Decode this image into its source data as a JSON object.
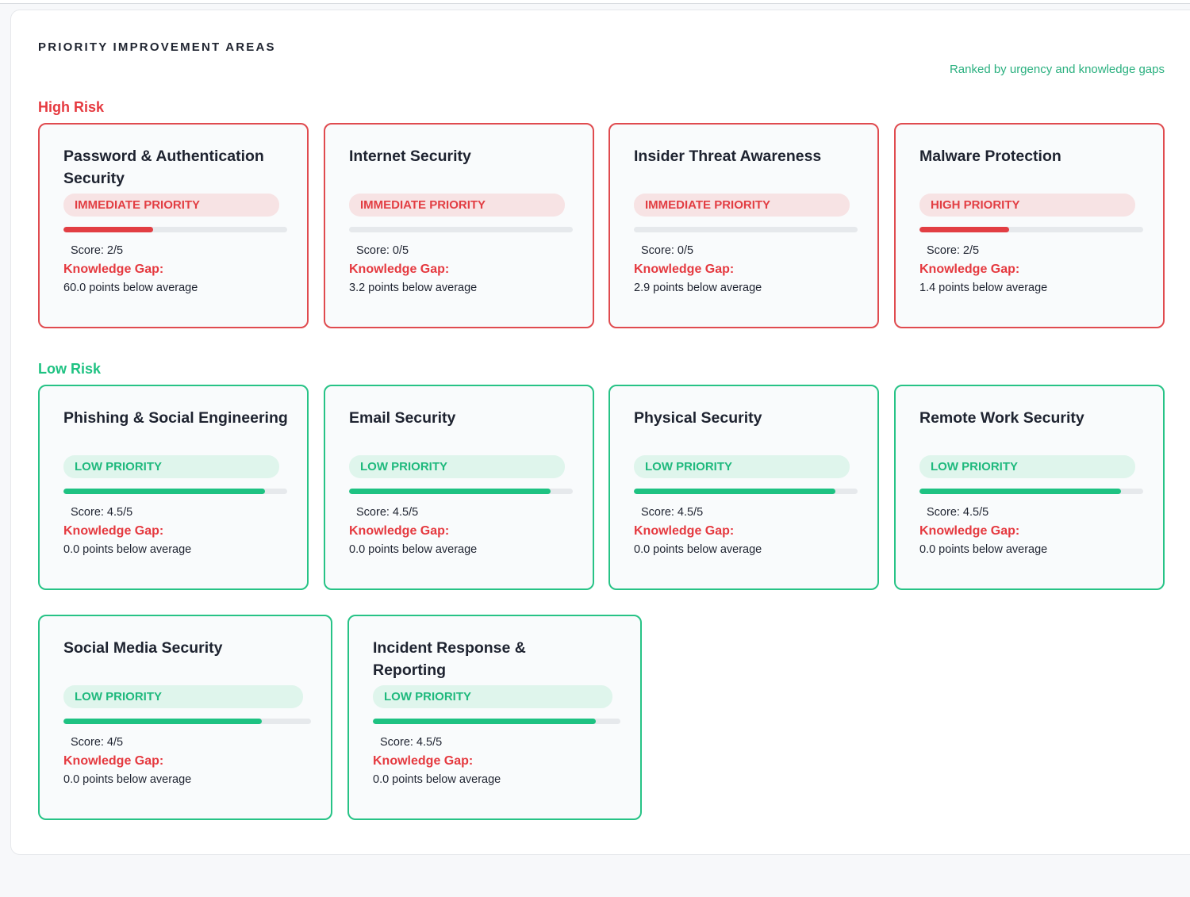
{
  "panel": {
    "title": "PRIORITY IMPROVEMENT AREAS",
    "subtitle": "Ranked by urgency and knowledge gaps"
  },
  "sections": {
    "high": {
      "label": "High Risk"
    },
    "low": {
      "label": "Low Risk"
    }
  },
  "colors": {
    "high_risk": "#e5393f",
    "low_risk": "#1ec282",
    "accent_text": "#2ab07f"
  },
  "knowledge_gap_label": "Knowledge Gap:",
  "high_cards": [
    {
      "title": "Password & Authentication Security",
      "priority": "IMMEDIATE PRIORITY",
      "score_text": "Score: 2/5",
      "score": 2,
      "max": 5,
      "gap": "60.0 points below average"
    },
    {
      "title": "Internet Security",
      "priority": "IMMEDIATE PRIORITY",
      "score_text": "Score: 0/5",
      "score": 0,
      "max": 5,
      "gap": "3.2 points below average"
    },
    {
      "title": "Insider Threat Awareness",
      "priority": "IMMEDIATE PRIORITY",
      "score_text": "Score: 0/5",
      "score": 0,
      "max": 5,
      "gap": "2.9 points below average"
    },
    {
      "title": "Malware Protection",
      "priority": "HIGH PRIORITY",
      "score_text": "Score: 2/5",
      "score": 2,
      "max": 5,
      "gap": "1.4 points below average"
    }
  ],
  "low_cards": [
    {
      "title": "Phishing & Social Engineering",
      "priority": "LOW PRIORITY",
      "score_text": "Score: 4.5/5",
      "score": 4.5,
      "max": 5,
      "gap": "0.0 points below average"
    },
    {
      "title": "Email Security",
      "priority": "LOW PRIORITY",
      "score_text": "Score: 4.5/5",
      "score": 4.5,
      "max": 5,
      "gap": "0.0 points below average"
    },
    {
      "title": "Physical Security",
      "priority": "LOW PRIORITY",
      "score_text": "Score: 4.5/5",
      "score": 4.5,
      "max": 5,
      "gap": "0.0 points below average"
    },
    {
      "title": "Remote Work Security",
      "priority": "LOW PRIORITY",
      "score_text": "Score: 4.5/5",
      "score": 4.5,
      "max": 5,
      "gap": "0.0 points below average"
    },
    {
      "title": "Social Media Security",
      "priority": "LOW PRIORITY",
      "score_text": "Score: 4/5",
      "score": 4,
      "max": 5,
      "gap": "0.0 points below average"
    },
    {
      "title": "Incident Response & Reporting",
      "priority": "LOW PRIORITY",
      "score_text": "Score: 4.5/5",
      "score": 4.5,
      "max": 5,
      "gap": "0.0 points below average"
    }
  ]
}
